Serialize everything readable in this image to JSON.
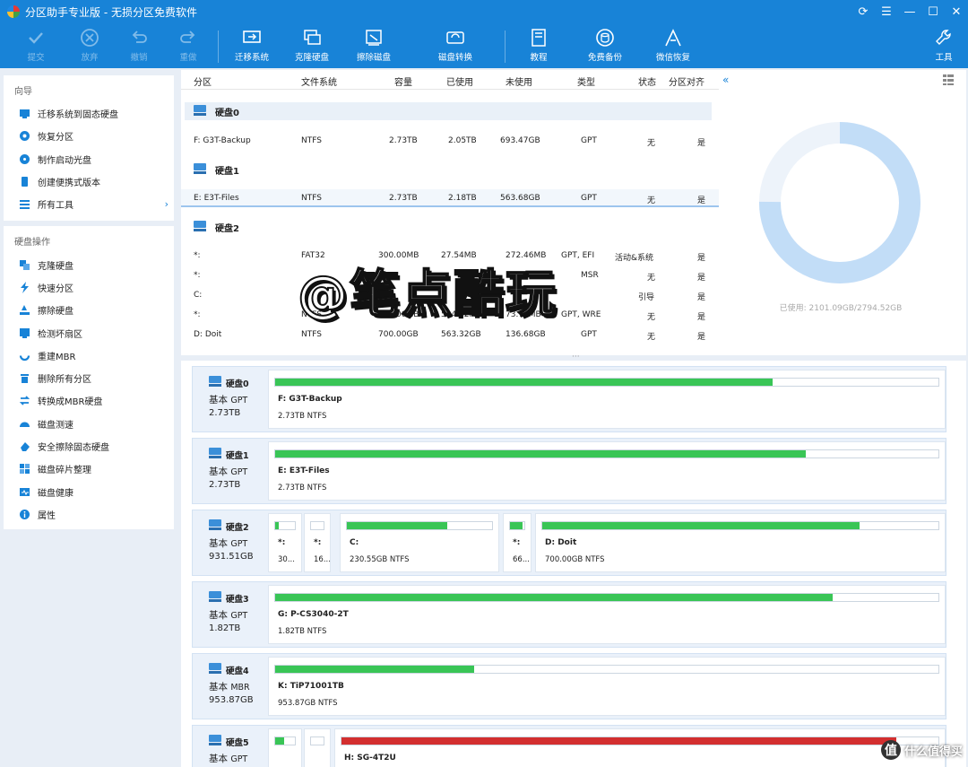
{
  "app": {
    "title": "分区助手专业版 - 无损分区免费软件"
  },
  "toolbar": [
    {
      "label": "提交",
      "icon": "check-icon",
      "disabled": true
    },
    {
      "label": "放弃",
      "icon": "cancel-icon",
      "disabled": true
    },
    {
      "label": "撤销",
      "icon": "undo-icon",
      "disabled": true
    },
    {
      "label": "重做",
      "icon": "redo-icon",
      "disabled": true
    },
    {
      "label": "迁移系统",
      "icon": "migrate-os-icon",
      "disabled": false
    },
    {
      "label": "克隆硬盘",
      "icon": "clone-disk-icon",
      "disabled": false
    },
    {
      "label": "擦除磁盘",
      "icon": "wipe-disk-icon",
      "disabled": false
    },
    {
      "label": "磁盘转换",
      "icon": "disk-convert-icon",
      "disabled": false
    },
    {
      "label": "教程",
      "icon": "tutorial-icon",
      "disabled": false
    },
    {
      "label": "免费备份",
      "icon": "backup-icon",
      "disabled": false
    },
    {
      "label": "微信恢复",
      "icon": "wechat-recovery-icon",
      "disabled": false
    },
    {
      "label": "工具",
      "icon": "tools-icon",
      "disabled": false
    }
  ],
  "sidebar": {
    "wizard_title": "向导",
    "wizard_items": [
      {
        "label": "迁移系统到固态硬盘",
        "icon": "migrate-icon"
      },
      {
        "label": "恢复分区",
        "icon": "recover-icon"
      },
      {
        "label": "制作启动光盘",
        "icon": "boot-disc-icon"
      },
      {
        "label": "创建便携式版本",
        "icon": "portable-icon"
      },
      {
        "label": "所有工具",
        "icon": "all-tools-icon",
        "arrow": "›"
      }
    ],
    "ops_title": "硬盘操作",
    "ops_items": [
      {
        "label": "克隆硬盘",
        "icon": "clone-icon"
      },
      {
        "label": "快速分区",
        "icon": "lightning-icon"
      },
      {
        "label": "擦除硬盘",
        "icon": "eraser-icon"
      },
      {
        "label": "检测坏扇区",
        "icon": "scan-icon"
      },
      {
        "label": "重建MBR",
        "icon": "rebuild-icon"
      },
      {
        "label": "删除所有分区",
        "icon": "trash-icon"
      },
      {
        "label": "转换成MBR硬盘",
        "icon": "convert-icon"
      },
      {
        "label": "磁盘测速",
        "icon": "speed-icon"
      },
      {
        "label": "安全擦除固态硬盘",
        "icon": "secure-erase-icon"
      },
      {
        "label": "磁盘碎片整理",
        "icon": "defrag-icon"
      },
      {
        "label": "磁盘健康",
        "icon": "health-icon"
      },
      {
        "label": "属性",
        "icon": "info-icon"
      }
    ]
  },
  "table": {
    "headers": [
      "分区",
      "文件系统",
      "容量",
      "已使用",
      "未使用",
      "类型",
      "状态",
      "分区对齐"
    ],
    "groups": [
      {
        "disk": "硬盘0",
        "rows": [
          [
            "F: G3T-Backup",
            "NTFS",
            "2.73TB",
            "2.05TB",
            "693.47GB",
            "GPT",
            "无",
            "是"
          ]
        ]
      },
      {
        "disk": "硬盘1",
        "rows": [
          [
            "E: E3T-Files",
            "NTFS",
            "2.73TB",
            "2.18TB",
            "563.68GB",
            "GPT",
            "无",
            "是"
          ]
        ]
      },
      {
        "disk": "硬盘2",
        "rows": [
          [
            "*:",
            "FAT32",
            "300.00MB",
            "27.54MB",
            "272.46MB",
            "GPT, EFI",
            "活动&系统",
            "是"
          ],
          [
            "*:",
            "",
            "",
            "",
            "",
            "MSR",
            "无",
            "是"
          ],
          [
            "C:",
            "",
            "",
            "",
            "",
            "",
            "引导",
            "是"
          ],
          [
            "*:",
            "NTFS",
            "660.00MB",
            "594.22MB",
            "73.78MB",
            "GPT, WRE",
            "无",
            "是"
          ],
          [
            "D: Doit",
            "NTFS",
            "700.00GB",
            "563.32GB",
            "136.68GB",
            "GPT",
            "无",
            "是"
          ]
        ]
      }
    ]
  },
  "donut": {
    "used_fraction": 0.7518,
    "label": "已使用: 2101.09GB/2794.52GB",
    "used_color": "#c2ddf7",
    "free_color": "#edf3fa"
  },
  "watermark": "@笔点酷玩",
  "disks": [
    {
      "name": "硬盘0",
      "type": "基本",
      "style": "GPT",
      "size": "2.73TB",
      "parts": [
        {
          "name": "F: G3T-Backup",
          "info": "2.73TB NTFS",
          "fill": 0.75,
          "color": "green"
        }
      ]
    },
    {
      "name": "硬盘1",
      "type": "基本",
      "style": "GPT",
      "size": "2.73TB",
      "parts": [
        {
          "name": "E: E3T-Files",
          "info": "2.73TB NTFS",
          "fill": 0.8,
          "color": "green"
        }
      ]
    },
    {
      "name": "硬盘2",
      "type": "基本",
      "style": "GPT",
      "size": "931.51GB",
      "parts": [
        {
          "name": "*:",
          "info": "30...",
          "fill": 0.2,
          "color": "green"
        },
        {
          "name": "*:",
          "info": "16...",
          "fill": 0.0,
          "color": "green"
        },
        {
          "name": "C:",
          "info": "230.55GB NTFS",
          "fill": 0.69,
          "color": "green"
        },
        {
          "name": "*:",
          "info": "66...",
          "fill": 0.9,
          "color": "green"
        },
        {
          "name": "D: Doit",
          "info": "700.00GB NTFS",
          "fill": 0.8,
          "color": "green"
        }
      ]
    },
    {
      "name": "硬盘3",
      "type": "基本",
      "style": "GPT",
      "size": "1.82TB",
      "parts": [
        {
          "name": "G: P-CS3040-2T",
          "info": "1.82TB NTFS",
          "fill": 0.84,
          "color": "green"
        }
      ]
    },
    {
      "name": "硬盘4",
      "type": "基本",
      "style": "MBR",
      "size": "953.87GB",
      "parts": [
        {
          "name": "K: TiP71001TB",
          "info": "953.87GB NTFS",
          "fill": 0.3,
          "color": "green"
        }
      ]
    },
    {
      "name": "硬盘5",
      "type": "基本",
      "style": "GPT",
      "size": "",
      "parts": [
        {
          "name": "",
          "info": "",
          "fill": 0.45,
          "color": "green"
        },
        {
          "name": "",
          "info": "",
          "fill": 0.0,
          "color": "green"
        },
        {
          "name": "H: SG-4T2U",
          "info": "",
          "fill": 0.93,
          "color": "red"
        }
      ]
    }
  ],
  "brand": {
    "glyph": "值",
    "text": "什么值得买"
  }
}
